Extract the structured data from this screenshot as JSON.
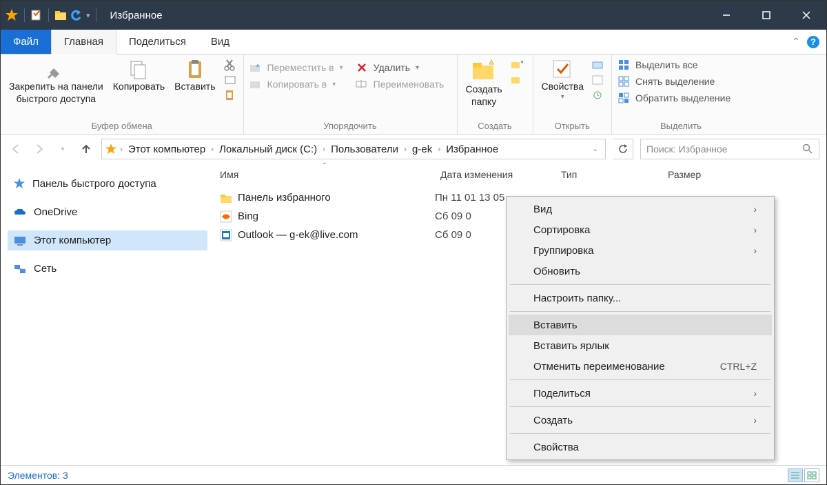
{
  "window": {
    "title": "Избранное"
  },
  "tabs": {
    "file": "Файл",
    "home": "Главная",
    "share": "Поделиться",
    "view": "Вид"
  },
  "ribbon": {
    "clipboard": {
      "pin": "Закрепить на панели\nбыстрого доступа",
      "copy": "Копировать",
      "paste": "Вставить",
      "cut_tip": "Вырезать",
      "copypath_tip": "Копировать путь",
      "pasteshort_tip": "Вставить ярлык",
      "group": "Буфер обмена"
    },
    "organize": {
      "move": "Переместить в",
      "copyto": "Копировать в",
      "delete": "Удалить",
      "rename": "Переименовать",
      "group": "Упорядочить"
    },
    "new": {
      "folder": "Создать\nпапку",
      "group": "Создать"
    },
    "open": {
      "props": "Свойства",
      "group": "Открыть"
    },
    "select": {
      "all": "Выделить все",
      "none": "Снять выделение",
      "invert": "Обратить выделение",
      "group": "Выделить"
    }
  },
  "breadcrumb": [
    "Этот компьютер",
    "Локальный диск (C:)",
    "Пользователи",
    "g-ek",
    "Избранное"
  ],
  "search": {
    "placeholder": "Поиск: Избранное"
  },
  "sidebar": {
    "quick": "Панель быстрого доступа",
    "onedrive": "OneDrive",
    "thispc": "Этот компьютер",
    "network": "Сеть"
  },
  "columns": {
    "name": "Имя",
    "date": "Дата изменения",
    "type": "Тип",
    "size": "Размер"
  },
  "files": [
    {
      "name": "Панель избранного",
      "date": "Пн 11 01 13 05",
      "type": "",
      "icon": "folder"
    },
    {
      "name": "Bing",
      "date": "Сб 09 0",
      "type": "",
      "icon": "url"
    },
    {
      "name": "Outlook — g-ek@live.com",
      "date": "Сб 09 0",
      "type": "",
      "icon": "url2"
    }
  ],
  "context": {
    "view": "Вид",
    "sort": "Сортировка",
    "group": "Группировка",
    "refresh": "Обновить",
    "customize": "Настроить папку...",
    "paste": "Вставить",
    "pastelink": "Вставить ярлык",
    "undo": "Отменить переименование",
    "undo_shortcut": "CTRL+Z",
    "share": "Поделиться",
    "create": "Создать",
    "props": "Свойства"
  },
  "status": {
    "items_label": "Элементов:",
    "items_count": "3"
  }
}
